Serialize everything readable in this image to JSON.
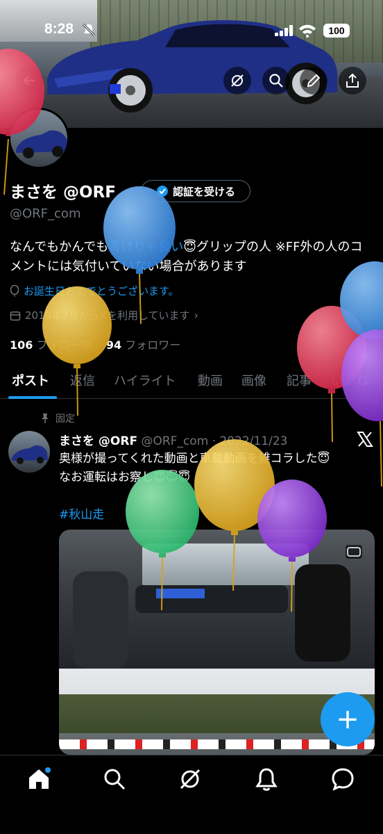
{
  "status_bar": {
    "time": "8:28",
    "battery": "100"
  },
  "profile": {
    "name": "まさを @ORF",
    "verify_button": "認証を受ける",
    "handle": "@ORF_com",
    "bio_prefix": "なんでもかんでも",
    "bio_link": "青けりゃ良い",
    "bio_suffix": "😇グリップの人 ※FF外の人のコメントには気付いていない場合があります",
    "birthday": "お誕生日おめでとうございます。",
    "joined": "2019年2月からXを利用しています",
    "following_count": "106",
    "following_label": "フォロー中",
    "followers_count": "94",
    "followers_label": "フォロワー"
  },
  "tabs": [
    {
      "label": "ポスト"
    },
    {
      "label": "返信"
    },
    {
      "label": "ハイライト"
    },
    {
      "label": "動画"
    },
    {
      "label": "画像"
    },
    {
      "label": "記事"
    },
    {
      "label": "いいね"
    }
  ],
  "post": {
    "pinned_label": "固定",
    "author": "まさを @ORF",
    "handle": "@ORF_com",
    "date": "2022/11/23",
    "line1": "奥様が撮ってくれた動画と車載動画を雑コラした😇",
    "line2": "なお運転はお察し😇😇😇",
    "hashtag": "#秋山走"
  },
  "fab_label": "+",
  "colors": {
    "accent": "#1d9bf0",
    "background": "#000000",
    "muted": "#71767b"
  },
  "icons": [
    "back-icon",
    "grok-icon",
    "search-icon",
    "edit-icon",
    "share-icon",
    "home-icon",
    "explore-icon",
    "notifications-icon",
    "messages-icon"
  ]
}
